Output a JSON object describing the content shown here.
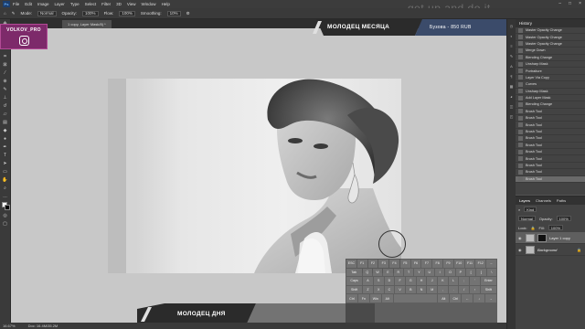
{
  "menubar": {
    "app_badge": "Ps",
    "items": [
      "File",
      "Edit",
      "Image",
      "Layer",
      "Type",
      "Select",
      "Filter",
      "3D",
      "View",
      "Window",
      "Help"
    ],
    "window_controls": [
      "–",
      "□",
      "×"
    ]
  },
  "watermark": "get up and do it",
  "options_bar": {
    "mode_label": "Mode:",
    "mode_value": "Normal",
    "opacity_label": "Opacity:",
    "opacity_value": "100%",
    "flow_label": "Flow:",
    "flow_value": "100%",
    "smoothing_label": "Smoothing:",
    "smoothing_value": "10%"
  },
  "document_tab": "1 copy, Layer Mask/8) *",
  "instagram_card": {
    "nickname": "VOLKOV_PRO",
    "icon": "instagram-icon"
  },
  "top_banner": {
    "title": "МОЛОДЕЦ МЕСЯЦА",
    "subtitle": "Бузова - 850 RUB"
  },
  "bottom_banner": {
    "title": "МОЛОДЕЦ ДНЯ"
  },
  "status_bar": {
    "zoom": "16.67%",
    "doc": "Doc: 16.4M/35.2M"
  },
  "history_panel": {
    "title": "History",
    "items": [
      "Master Opacity Change",
      "Master Opacity Change",
      "Master Opacity Change",
      "Merge Down",
      "Blending Change",
      "Unsharp Mask",
      "Portraiture",
      "Layer Via Copy",
      "Curves",
      "Unsharp Mask",
      "Add Layer Mask",
      "Blending Change",
      "Brush Tool",
      "Brush Tool",
      "Brush Tool",
      "Brush Tool",
      "Brush Tool",
      "Brush Tool",
      "Brush Tool",
      "Brush Tool",
      "Brush Tool",
      "Brush Tool",
      "Brush Tool"
    ]
  },
  "layers_panel": {
    "tabs": [
      "Layers",
      "Channels",
      "Paths"
    ],
    "kind_label": "Kind",
    "blend_mode": "Normal",
    "opacity_label": "Opacity:",
    "opacity_value": "100%",
    "lock_label": "Lock:",
    "fill_label": "Fill:",
    "fill_value": "100%",
    "layers": [
      {
        "name": "Layer 1 copy",
        "active": true
      },
      {
        "name": "Background",
        "active": false
      }
    ]
  },
  "keyboard": {
    "row1": [
      "ESC",
      "F1",
      "F2",
      "F3",
      "F4",
      "F5",
      "F6",
      "F7",
      "F8",
      "F9",
      "F10",
      "F11",
      "F12",
      "←"
    ],
    "row2": [
      "Tab",
      "Q",
      "W",
      "E",
      "R",
      "T",
      "Y",
      "U",
      "I",
      "O",
      "P",
      "[",
      "]",
      "\\"
    ],
    "row3": [
      "Caps",
      "A",
      "S",
      "D",
      "F",
      "G",
      "H",
      "J",
      "K",
      "L",
      ";",
      "'",
      "Enter"
    ],
    "row4": [
      "Shift",
      "Z",
      "X",
      "C",
      "V",
      "B",
      "N",
      "M",
      ",",
      ".",
      "/",
      "↑",
      "Shift"
    ],
    "row5": [
      "Ctrl",
      "Fn",
      "Win",
      "Alt",
      "",
      "Alt",
      "Ctrl",
      "←",
      "↓",
      "→"
    ]
  }
}
